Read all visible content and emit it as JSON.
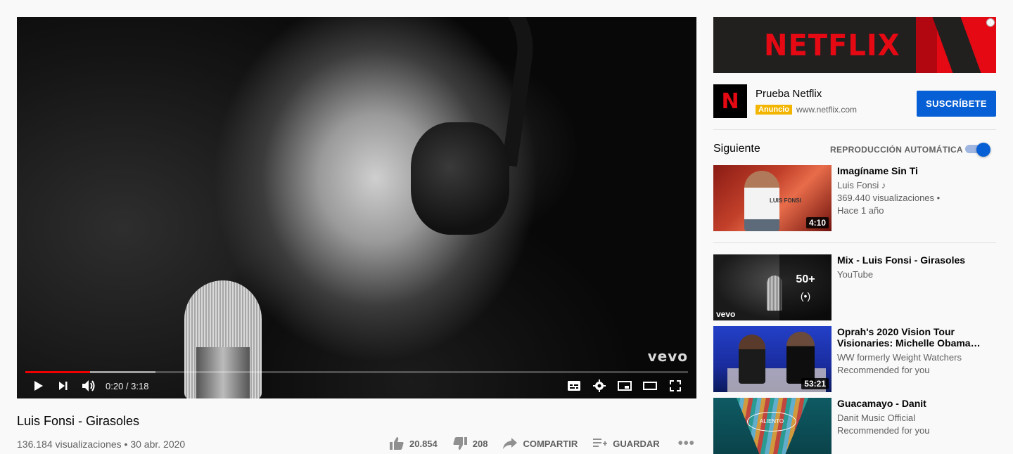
{
  "player": {
    "time_display": "0:20 / 3:18",
    "watermark": "vevo",
    "played_fraction": 0.098,
    "buffered_fraction": 0.196
  },
  "video": {
    "title": "Luis Fonsi - Girasoles",
    "stats": "136.184 visualizaciones • 30 abr. 2020",
    "like_count": "20.854",
    "dislike_count": "208",
    "share_label": "COMPARTIR",
    "save_label": "GUARDAR"
  },
  "ad": {
    "banner_text": "NETFLIX",
    "info_icon": "ⓘ",
    "logo_letter": "N",
    "title": "Prueba Netflix",
    "badge": "Anuncio",
    "url": "www.netflix.com",
    "cta": "SUSCRÍBETE"
  },
  "up_next": {
    "heading": "Siguiente",
    "autoplay_label": "REPRODUCCIÓN AUTOMÁTICA",
    "autoplay_on": true
  },
  "recommendations": [
    {
      "title": "Imagíname Sin Ti",
      "channel": "Luis Fonsi ♪",
      "meta1": "369.440 visualizaciones •",
      "meta2": "Hace 1 año",
      "duration": "4:10",
      "thumb_text": "LUIS FONSI"
    },
    {
      "title": "Mix - Luis Fonsi - Girasoles",
      "channel": "YouTube",
      "overlay_count": "50+",
      "overlay_icon": "(•)",
      "thumb_text": "vevo"
    },
    {
      "title": "Oprah's 2020 Vision Tour Visionaries: Michelle Obama…",
      "channel": "WW formerly Weight Watchers",
      "meta1": "Recommended for you",
      "duration": "53:21"
    },
    {
      "title": "Guacamayo - Danit",
      "channel": "Danit Music Official",
      "meta1": "Recommended for you",
      "thumb_text": "ALIENTO"
    }
  ],
  "colors": {
    "accent_blue": "#065fd4",
    "progress_red": "#ee0000",
    "netflix_red": "#e50914",
    "ad_badge": "#f2b600"
  }
}
